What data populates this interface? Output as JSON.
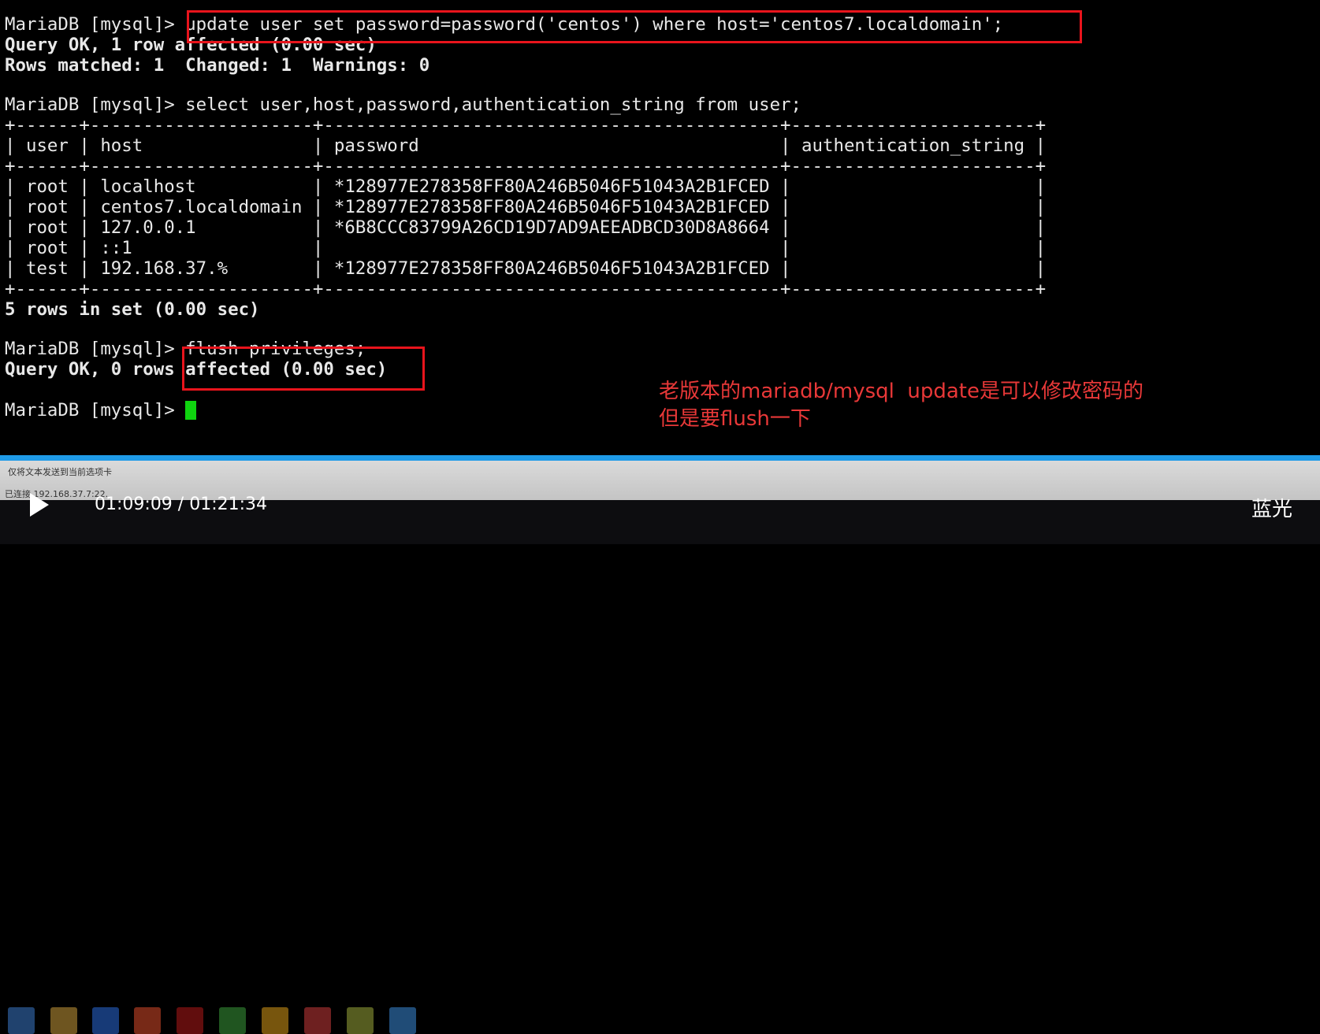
{
  "terminal": {
    "lines": [
      "MariaDB [mysql]> update user set password=password('centos') where host='centos7.localdomain';",
      "Query OK, 1 row affected (0.00 sec)",
      "Rows matched: 1  Changed: 1  Warnings: 0",
      "",
      "MariaDB [mysql]> select user,host,password,authentication_string from user;",
      "+------+---------------------+-------------------------------------------+-----------------------+",
      "| user | host                | password                                  | authentication_string |",
      "+------+---------------------+-------------------------------------------+-----------------------+",
      "| root | localhost           | *128977E278358FF80A246B5046F51043A2B1FCED |                       |",
      "| root | centos7.localdomain | *128977E278358FF80A246B5046F51043A2B1FCED |                       |",
      "| root | 127.0.0.1           | *6B8CCC83799A26CD19D7AD9AEEADBCD30D8A8664 |                       |",
      "| root | ::1                 |                                           |                       |",
      "| test | 192.168.37.%        | *128977E278358FF80A246B5046F51043A2B1FCED |                       |",
      "+------+---------------------+-------------------------------------------+-----------------------+",
      "5 rows in set (0.00 sec)",
      "",
      "MariaDB [mysql]> flush privileges;",
      "Query OK, 0 rows affected (0.00 sec)",
      "",
      "MariaDB [mysql]> "
    ],
    "cursor_color": "#0fd40f",
    "highlight_color": "#e8141c"
  },
  "annotation": {
    "line1": "老版本的mariadb/mysql  update是可以修改密码的",
    "line2": "但是要flush一下",
    "color": "#e83838"
  },
  "statusbar": {
    "send_hint": "仅将文本发送到当前选项卡",
    "connection": "已连接 192.168.37.7:22."
  },
  "player": {
    "current_time": "01:09:09",
    "separator": " / ",
    "total_time": "01:21:34",
    "progress_fraction": 0.848,
    "quality_label": "蓝光",
    "accent_color": "#1f9be8"
  }
}
